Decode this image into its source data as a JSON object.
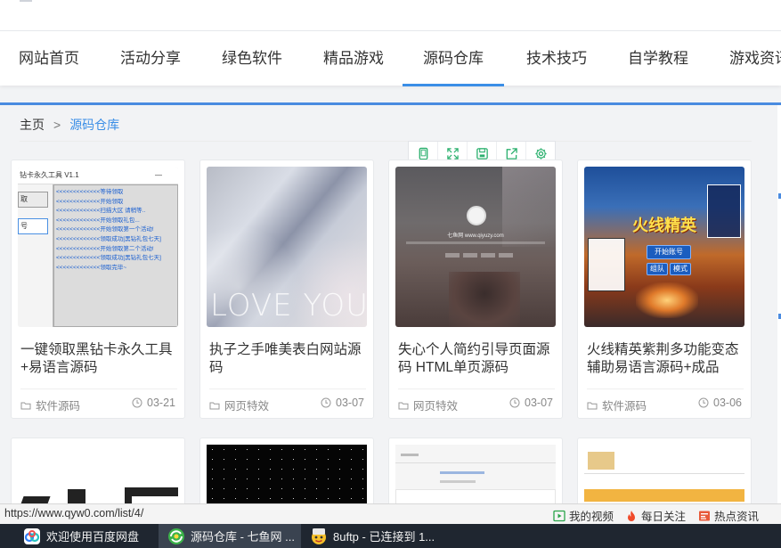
{
  "nav": {
    "items": [
      {
        "label": "网站首页"
      },
      {
        "label": "活动分享"
      },
      {
        "label": "绿色软件"
      },
      {
        "label": "精品游戏"
      },
      {
        "label": "源码仓库"
      },
      {
        "label": "技术技巧"
      },
      {
        "label": "自学教程"
      },
      {
        "label": "游戏资讯"
      }
    ],
    "active_index": 4
  },
  "breadcrumb": {
    "home": "主页",
    "separator": ">",
    "current": "源码仓库"
  },
  "toolbar": {
    "icons": [
      "mobile-icon",
      "fullscreen-icon",
      "save-icon",
      "share-icon",
      "settings-icon"
    ]
  },
  "thumb_texts": {
    "tool_title": "钻卡永久工具 V1.1",
    "tool_minimize": "—",
    "tool_left": [
      "取",
      "号"
    ],
    "tool_log": [
      "<<<<<<<<<<<<<等待领取",
      "<<<<<<<<<<<<<开始领取",
      "<<<<<<<<<<<<<扫描大区 请稍等..",
      "<<<<<<<<<<<<<开始领取礼包...",
      "<<<<<<<<<<<<<开始领取第一个活动!",
      "<<<<<<<<<<<<<领取成功[黑钻礼包七天]",
      "<<<<<<<<<<<<<开始领取第二个活动!",
      "<<<<<<<<<<<<<领取成功[黑钻礼包七天]",
      "<<<<<<<<<<<<<领取完毕~"
    ],
    "love": "LOVE YOU",
    "qiyu_name": "七鱼网 www.qiyuzy.com",
    "game_title": "火线精英",
    "game_buttons": [
      "开始账号",
      "组队",
      "模式"
    ]
  },
  "cards": [
    {
      "title": "一键领取黑钻卡永久工具+易语言源码",
      "category": "软件源码",
      "date": "03-21"
    },
    {
      "title": "执子之手唯美表白网站源码",
      "category": "网页特效",
      "date": "03-07"
    },
    {
      "title": "失心个人简约引导页面源码 HTML单页源码",
      "category": "网页特效",
      "date": "03-07"
    },
    {
      "title": "火线精英紫荆多功能变态辅助易语言源码+成品",
      "category": "软件源码",
      "date": "03-06"
    }
  ],
  "statusbar": {
    "url": "https://www.qyw0.com/list/4/",
    "links": [
      {
        "label": "我的视频",
        "icon": "video-icon"
      },
      {
        "label": "每日关注",
        "icon": "flame-icon"
      },
      {
        "label": "热点资讯",
        "icon": "news-icon"
      }
    ]
  },
  "taskbar": {
    "items": [
      {
        "label": "欢迎使用百度网盘",
        "icon": "baidu-netdisk-icon"
      },
      {
        "label": "源码仓库 - 七鱼网 ...",
        "icon": "browser-icon"
      },
      {
        "label": "8uftp - 已连接到 1...",
        "icon": "ftp-icon"
      }
    ]
  },
  "colors": {
    "accent": "#3a8ee6",
    "nav_active_line": "#3a8ee6",
    "taskbar_bg": "#1f2630"
  }
}
